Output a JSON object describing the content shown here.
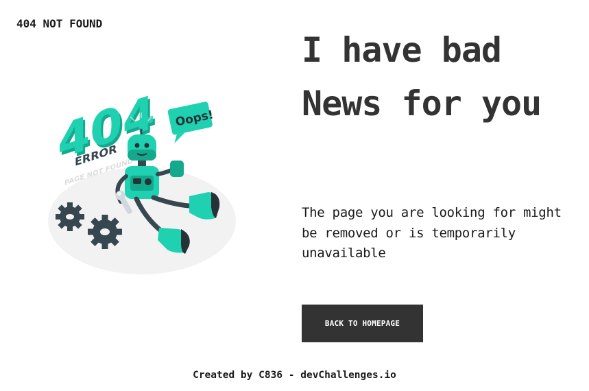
{
  "header": {
    "label": "404 NOT FOUND"
  },
  "illustration": {
    "big_text": "404",
    "error_text": "ERROR",
    "sub_text": "PAGE NOT FOUND",
    "bubble_text": "Oops!",
    "icon": "robot-404-illustration",
    "colors": {
      "teal": "#1fd1b0",
      "teal_dark": "#12a98c",
      "dark": "#263238",
      "floor": "#f2f2f2",
      "gear": "#37474f"
    }
  },
  "main": {
    "headline": "I have bad News for you",
    "description": "The page you are looking for might be removed or is temporarily unavailable",
    "button_label": "BACK TO HOMEPAGE"
  },
  "footer": {
    "text": "Created by C836 - devChallenges.io"
  },
  "theme": {
    "text": "#333333",
    "button_bg": "#333333",
    "button_text": "#ffffff"
  }
}
